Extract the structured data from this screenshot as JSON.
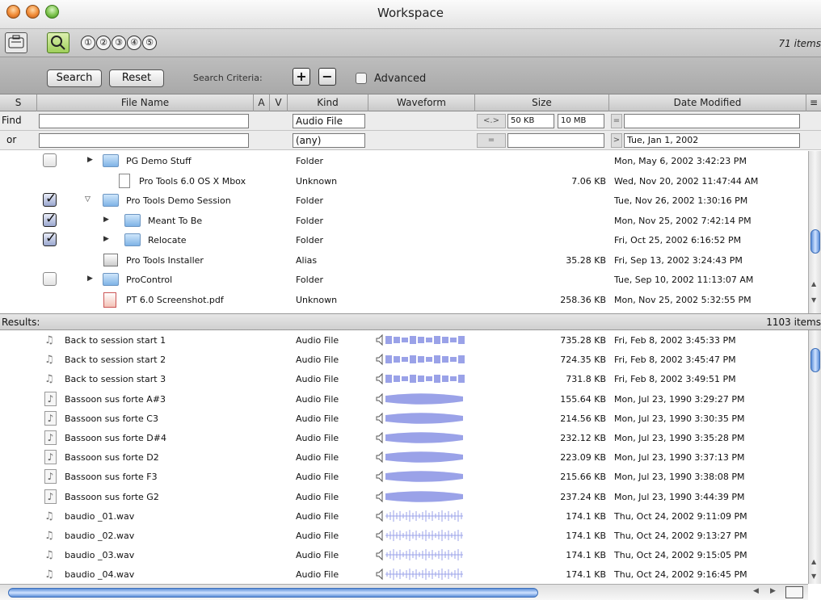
{
  "window": {
    "title": "Workspace"
  },
  "toolbar": {
    "circles": [
      "①",
      "②",
      "③",
      "④",
      "⑤"
    ],
    "item_count": "71 items"
  },
  "search": {
    "search_label": "Search",
    "reset_label": "Reset",
    "criteria_label": "Search Criteria:",
    "plus": "+",
    "minus": "−",
    "advanced_label": "Advanced",
    "advanced_checked": false
  },
  "columns": {
    "s": "S",
    "name": "File Name",
    "a": "A",
    "v": "V",
    "kind": "Kind",
    "waveform": "Waveform",
    "size": "Size",
    "date": "Date Modified"
  },
  "find": {
    "find_label": "Find",
    "or_label": "or",
    "row1": {
      "name": "",
      "kind": "Audio File",
      "size_op": "<.>",
      "size_min": "50 KB",
      "size_max": "10 MB",
      "date_op": "=",
      "date": ""
    },
    "row2": {
      "name": "",
      "kind": "(any)",
      "size_op": "=",
      "size": "",
      "date_op": ">",
      "date": "Tue, Jan 1, 2002"
    }
  },
  "workspace": [
    {
      "checked": false,
      "disclosure": "closed",
      "icon": "folder",
      "indent": 0,
      "name": "PG Demo Stuff",
      "kind": "Folder",
      "size": "",
      "date": "Mon, May 6, 2002 3:42:23 PM"
    },
    {
      "checked": null,
      "disclosure": "",
      "icon": "doc",
      "indent": 1,
      "name": "Pro Tools 6.0 OS X Mbox",
      "kind": "Unknown",
      "size": "7.06 KB",
      "date": "Wed, Nov 20, 2002 11:47:44 AM"
    },
    {
      "checked": true,
      "disclosure": "open",
      "icon": "folder",
      "indent": 0,
      "name": "Pro Tools Demo Session",
      "kind": "Folder",
      "size": "",
      "date": "Tue, Nov 26, 2002 1:30:16 PM"
    },
    {
      "checked": true,
      "disclosure": "closed",
      "icon": "folder",
      "indent": 1,
      "name": "Meant To Be",
      "kind": "Folder",
      "size": "",
      "date": "Mon, Nov 25, 2002 7:42:14 PM"
    },
    {
      "checked": true,
      "disclosure": "closed",
      "icon": "folder",
      "indent": 1,
      "name": "Relocate",
      "kind": "Folder",
      "size": "",
      "date": "Fri, Oct 25, 2002 6:16:52 PM"
    },
    {
      "checked": null,
      "disclosure": "",
      "icon": "alias",
      "indent": 0,
      "name": "Pro Tools Installer",
      "kind": "Alias",
      "size": "35.28 KB",
      "date": "Fri, Sep 13, 2002 3:24:43 PM"
    },
    {
      "checked": false,
      "disclosure": "closed",
      "icon": "folder",
      "indent": 0,
      "name": "ProControl",
      "kind": "Folder",
      "size": "",
      "date": "Tue, Sep 10, 2002 11:13:07 AM"
    },
    {
      "checked": null,
      "disclosure": "",
      "icon": "pdf",
      "indent": 0,
      "name": "PT 6.0 Screenshot.pdf",
      "kind": "Unknown",
      "size": "258.36 KB",
      "date": "Mon, Nov 25, 2002 5:32:55 PM"
    }
  ],
  "results": {
    "label": "Results:",
    "count": "1103 items",
    "rows": [
      {
        "icon": "audio",
        "name": "Back to session start 1",
        "kind": "Audio File",
        "wave": "blocks",
        "size": "735.28 KB",
        "date": "Fri, Feb 8, 2002 3:45:33 PM"
      },
      {
        "icon": "audio",
        "name": "Back to session start 2",
        "kind": "Audio File",
        "wave": "blocks",
        "size": "724.35 KB",
        "date": "Fri, Feb 8, 2002 3:45:47 PM"
      },
      {
        "icon": "audio",
        "name": "Back to session start 3",
        "kind": "Audio File",
        "wave": "blocks",
        "size": "731.8 KB",
        "date": "Fri, Feb 8, 2002 3:49:51 PM"
      },
      {
        "icon": "audio2",
        "name": "Bassoon sus forte  A#3",
        "kind": "Audio File",
        "wave": "solid",
        "size": "155.64 KB",
        "date": "Mon, Jul 23, 1990 3:29:27 PM"
      },
      {
        "icon": "audio2",
        "name": "Bassoon sus forte  C3",
        "kind": "Audio File",
        "wave": "solid",
        "size": "214.56 KB",
        "date": "Mon, Jul 23, 1990 3:30:35 PM"
      },
      {
        "icon": "audio2",
        "name": "Bassoon sus forte  D#4",
        "kind": "Audio File",
        "wave": "solid",
        "size": "232.12 KB",
        "date": "Mon, Jul 23, 1990 3:35:28 PM"
      },
      {
        "icon": "audio2",
        "name": "Bassoon sus forte  D2",
        "kind": "Audio File",
        "wave": "solid",
        "size": "223.09 KB",
        "date": "Mon, Jul 23, 1990 3:37:13 PM"
      },
      {
        "icon": "audio2",
        "name": "Bassoon sus forte  F3",
        "kind": "Audio File",
        "wave": "solid",
        "size": "215.66 KB",
        "date": "Mon, Jul 23, 1990 3:38:08 PM"
      },
      {
        "icon": "audio2",
        "name": "Bassoon sus forte  G2",
        "kind": "Audio File",
        "wave": "solid",
        "size": "237.24 KB",
        "date": "Mon, Jul 23, 1990 3:44:39 PM"
      },
      {
        "icon": "audio",
        "name": "baudio _01.wav",
        "kind": "Audio File",
        "wave": "spikes",
        "size": "174.1 KB",
        "date": "Thu, Oct 24, 2002 9:11:09 PM"
      },
      {
        "icon": "audio",
        "name": "baudio _02.wav",
        "kind": "Audio File",
        "wave": "spikes",
        "size": "174.1 KB",
        "date": "Thu, Oct 24, 2002 9:13:27 PM"
      },
      {
        "icon": "audio",
        "name": "baudio _03.wav",
        "kind": "Audio File",
        "wave": "spikes",
        "size": "174.1 KB",
        "date": "Thu, Oct 24, 2002 9:15:05 PM"
      },
      {
        "icon": "audio",
        "name": "baudio _04.wav",
        "kind": "Audio File",
        "wave": "spikes",
        "size": "174.1 KB",
        "date": "Thu, Oct 24, 2002 9:16:45 PM"
      }
    ]
  },
  "colors": {
    "wave": "#9aa2e8",
    "selection": "#5d8fd9"
  }
}
